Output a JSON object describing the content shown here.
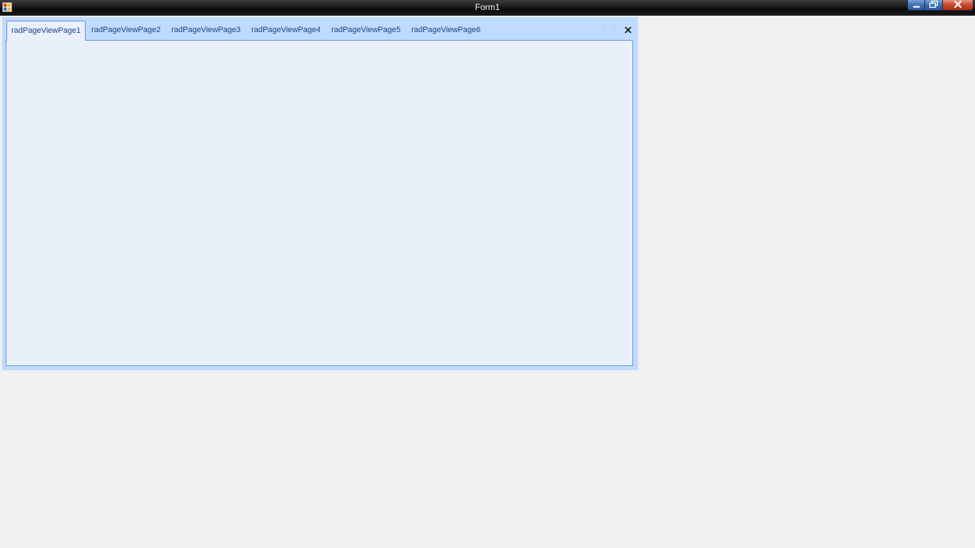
{
  "window": {
    "title": "Form1",
    "icon": "app-icon",
    "controls": {
      "minimize": "minimize-icon",
      "restore": "restore-icon",
      "close": "close-icon"
    }
  },
  "pageview": {
    "tabs": [
      {
        "label": "radPageViewPage1",
        "active": true
      },
      {
        "label": "radPageViewPage2",
        "active": false
      },
      {
        "label": "radPageViewPage3",
        "active": false
      },
      {
        "label": "radPageViewPage4",
        "active": false
      },
      {
        "label": "radPageViewPage5",
        "active": false
      },
      {
        "label": "radPageViewPage6",
        "active": false
      }
    ],
    "strip_buttons": {
      "scroll_left": "chevron-left-icon",
      "scroll_right": "chevron-right-icon",
      "close": "close-icon"
    }
  },
  "colors": {
    "frame": "#bfdbff",
    "tab_text": "#15428b",
    "content_bg": "#e9f0fa",
    "content_border": "#6593cf",
    "desktop_bg": "#f0f0f0"
  }
}
